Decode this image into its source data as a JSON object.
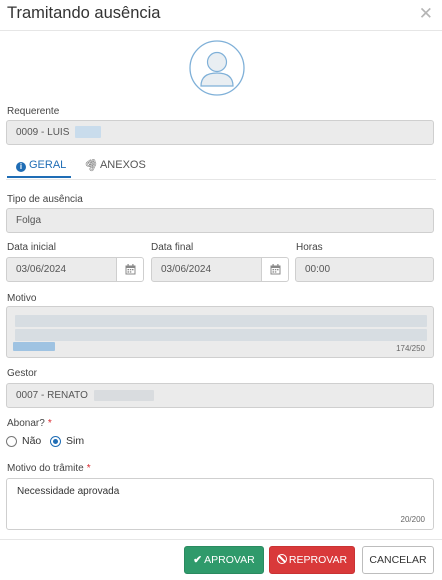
{
  "modal": {
    "title": "Tramitando ausência",
    "close_icon": "close-icon"
  },
  "requester": {
    "label": "Requerente",
    "value": "0009 - LUIS"
  },
  "tabs": [
    {
      "label": "GERAL",
      "icon": "info-icon",
      "active": true
    },
    {
      "label": "ANEXOS",
      "icon": "paperclip-icon",
      "active": false
    }
  ],
  "absence_type": {
    "label": "Tipo de ausência",
    "value": "Folga"
  },
  "start_date": {
    "label": "Data inicial",
    "value": "03/06/2024"
  },
  "end_date": {
    "label": "Data final",
    "value": "03/06/2024"
  },
  "hours": {
    "label": "Horas",
    "value": "00:00"
  },
  "reason": {
    "label": "Motivo",
    "counter": "174/250"
  },
  "manager": {
    "label": "Gestor",
    "value": "0007 - RENATO"
  },
  "excuse": {
    "label": "Abonar?",
    "required_mark": "*",
    "options": [
      "Não",
      "Sim"
    ],
    "selected": "Sim"
  },
  "step_reason": {
    "label": "Motivo do trâmite",
    "required_mark": "*",
    "value": "Necessidade aprovada",
    "counter": "20/200"
  },
  "actions": {
    "approve": "APROVAR",
    "reject": "REPROVAR",
    "cancel": "CANCELAR"
  },
  "colors": {
    "accent": "#1f6db5",
    "approve": "#2f9a6b",
    "reject": "#d9393a",
    "required": "#d9262c"
  }
}
